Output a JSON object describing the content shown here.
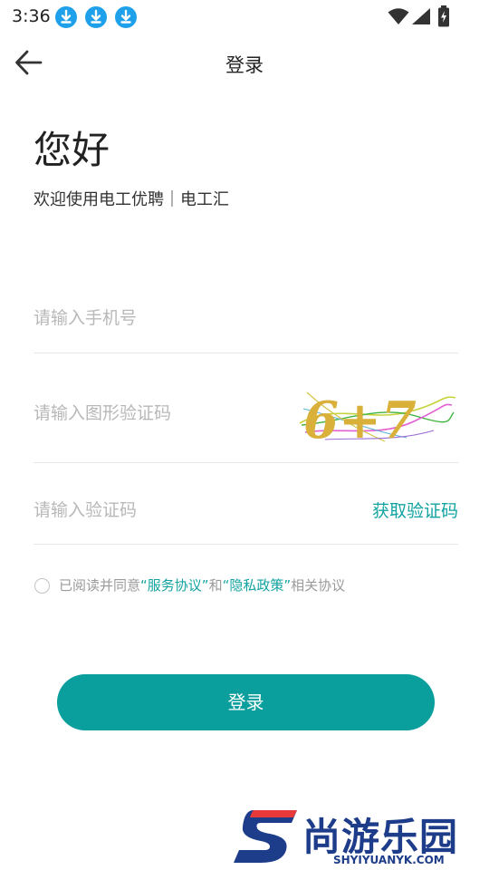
{
  "status_bar": {
    "time": "3:36",
    "notification_icons": [
      "download-icon",
      "download-icon",
      "download-icon"
    ],
    "system_icons": [
      "wifi-icon",
      "signal-icon",
      "battery-charging-icon"
    ]
  },
  "app_bar": {
    "back_icon": "arrow-left-icon",
    "title": "登录"
  },
  "header": {
    "greeting": "您好",
    "welcome": "欢迎使用电工优聘｜电工汇"
  },
  "form": {
    "phone_placeholder": "请输入手机号",
    "captcha_placeholder": "请输入图形验证码",
    "captcha_text": "6+7",
    "code_placeholder": "请输入验证码",
    "get_code_label": "获取验证码"
  },
  "agreement": {
    "prefix": "已阅读并同意",
    "service_link": "“服务协议”",
    "middle": "和",
    "privacy_link": "“隐私政策”",
    "suffix": "相关协议"
  },
  "login_button": "登录",
  "watermark": {
    "title": "尚游乐园",
    "url": "SHYIYUANYK.COM"
  },
  "colors": {
    "accent": "#0a9e9c",
    "link": "#12a3a0",
    "download_badge": "#1ea0ea",
    "watermark": "#1d3c8a"
  }
}
